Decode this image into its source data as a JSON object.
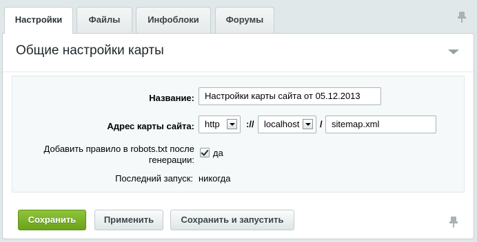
{
  "tabs": [
    {
      "label": "Настройки",
      "active": true
    },
    {
      "label": "Файлы",
      "active": false
    },
    {
      "label": "Инфоблоки",
      "active": false
    },
    {
      "label": "Форумы",
      "active": false
    }
  ],
  "section": {
    "title": "Общие настройки карты"
  },
  "form": {
    "name_label": "Название:",
    "name_value": "Настройки карты сайта от 05.12.2013",
    "address_label": "Адрес карты сайта:",
    "protocol_value": "http",
    "protocol_sep": "://",
    "domain_value": "localhost",
    "path_sep": "/",
    "file_value": "sitemap.xml",
    "robots_label_line1": "Добавить правило в robots.txt после",
    "robots_label_line2": "генерации:",
    "robots_checked": true,
    "robots_value_label": "да",
    "last_run_label": "Последний запуск:",
    "last_run_value": "никогда"
  },
  "buttons": {
    "save": "Сохранить",
    "apply": "Применить",
    "save_run": "Сохранить и запустить"
  },
  "icons": {
    "pin_top": "pin-icon",
    "pin_bottom": "pin-icon",
    "collapse": "collapse-triangle-icon",
    "select_arrow": "dropdown-arrow-icon"
  }
}
